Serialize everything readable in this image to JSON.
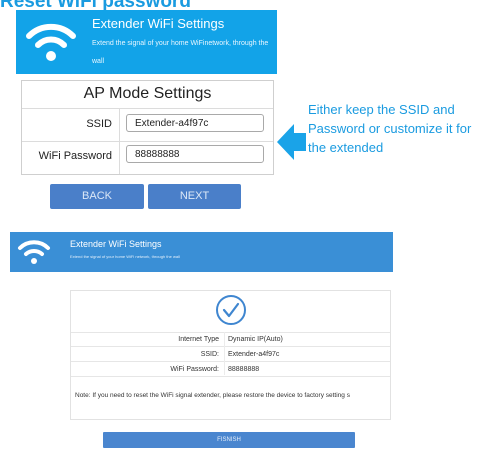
{
  "page": {
    "heading_partial": "Reset WiFi password"
  },
  "panel1": {
    "banner": {
      "title": "Extender WiFi Settings",
      "subtitle": "Extend the signal of your home WiFinetwork, through the wall",
      "bg_color": "#12a3e8",
      "icon": "wifi-icon"
    },
    "form": {
      "title": "AP Mode Settings",
      "ssid_label": "SSID",
      "ssid_value": "Extender-a4f97c",
      "password_label": "WiFi Password",
      "password_value": "88888888"
    },
    "buttons": {
      "back": "BACK",
      "next": "NEXT",
      "color": "#4a7fc9"
    }
  },
  "callout": {
    "text": "Either keep the SSID and Password or customize it for the extended",
    "arrow_icon": "left-arrow-icon",
    "color": "#1a9be0"
  },
  "panel2": {
    "banner": {
      "title": "Extender WiFi Settings",
      "subtitle": "Extend the signal of your home WiFi network, through the wall",
      "bg_color": "#3a8fd6",
      "icon": "wifi-icon"
    },
    "status_icon": "check-circle-icon",
    "rows": [
      {
        "key": "Internet Type",
        "value": "Dynamic IP(Auto)"
      },
      {
        "key": "SSID:",
        "value": "Extender-a4f97c"
      },
      {
        "key": "WiFi Password:",
        "value": "88888888"
      }
    ],
    "note": "Note: If you need to reset the WiFi signal extender, please restore the device to factory setting s",
    "finish": "FISNISH"
  }
}
